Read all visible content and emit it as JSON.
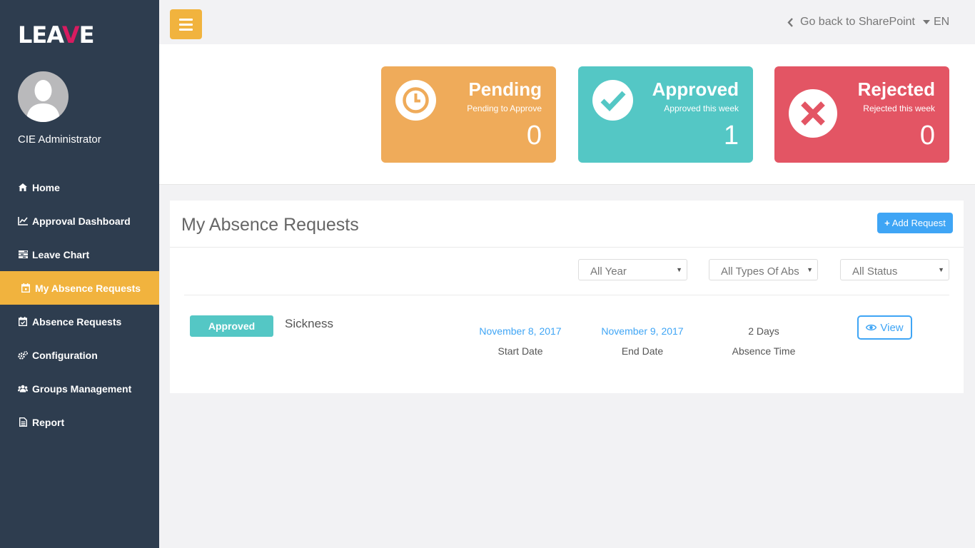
{
  "app": {
    "logo_text_1": "LEA",
    "logo_text_2": "V",
    "logo_text_3": "E",
    "accent_color": "#d81b60"
  },
  "user": {
    "name": "CIE Administrator"
  },
  "sidebar": {
    "items": [
      {
        "label": "Home",
        "icon": "home-icon"
      },
      {
        "label": "Approval Dashboard",
        "icon": "line-chart-icon"
      },
      {
        "label": "Leave Chart",
        "icon": "tasks-icon"
      },
      {
        "label": "My Absence Requests",
        "icon": "calendar-icon",
        "active": true
      },
      {
        "label": "Absence Requests",
        "icon": "calendar-check-icon"
      },
      {
        "label": "Configuration",
        "icon": "gears-icon"
      },
      {
        "label": "Groups Management",
        "icon": "users-icon"
      },
      {
        "label": "Report",
        "icon": "file-text-icon"
      }
    ]
  },
  "topbar": {
    "back_label": "Go back to SharePoint",
    "language": "EN"
  },
  "stats": {
    "pending": {
      "title": "Pending",
      "subtitle": "Pending to Approve",
      "count": "0",
      "color": "#efab5a"
    },
    "approved": {
      "title": "Approved",
      "subtitle": "Approved this week",
      "count": "1",
      "color": "#54c7c5"
    },
    "rejected": {
      "title": "Rejected",
      "subtitle": "Rejected this week",
      "count": "0",
      "color": "#e35564"
    }
  },
  "requests": {
    "title": "My Absence Requests",
    "add_label": "Add Request",
    "filters": {
      "year": "All Year",
      "type": "All Types Of Abs",
      "status": "All Status"
    },
    "rows": [
      {
        "status": "Approved",
        "type": "Sickness",
        "start_date": "November 8, 2017",
        "start_label": "Start Date",
        "end_date": "November 9, 2017",
        "end_label": "End Date",
        "absence_time": "2 Days",
        "absence_label": "Absence Time",
        "view_label": "View"
      }
    ]
  }
}
